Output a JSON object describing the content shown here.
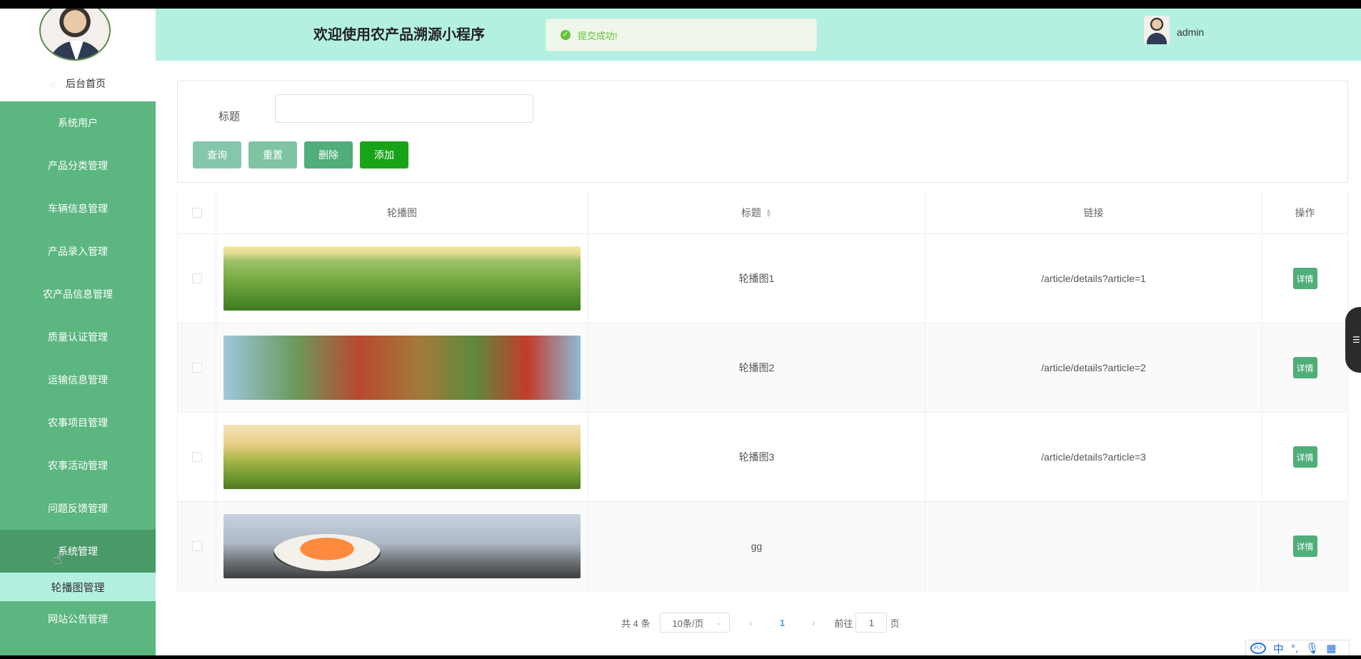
{
  "header": {
    "title": "欢迎使用农产品溯源小程序",
    "toast": "提交成功!",
    "user": "admin"
  },
  "sidebar": {
    "home": "后台首页",
    "items": [
      {
        "label": "系统用户"
      },
      {
        "label": "产品分类管理"
      },
      {
        "label": "车辆信息管理"
      },
      {
        "label": "产品录入管理"
      },
      {
        "label": "农产品信息管理"
      },
      {
        "label": "质量认证管理"
      },
      {
        "label": "运输信息管理"
      },
      {
        "label": "农事项目管理"
      },
      {
        "label": "农事活动管理"
      },
      {
        "label": "问题反馈管理"
      },
      {
        "label": "系统管理"
      }
    ],
    "submenu": [
      "轮播图管理",
      "网站公告管理"
    ]
  },
  "search": {
    "title_label": "标题",
    "title_value": "",
    "query": "查询",
    "reset": "重置",
    "delete": "删除",
    "add": "添加"
  },
  "table": {
    "headers": {
      "image": "轮播图",
      "title": "标题",
      "link": "链接",
      "op": "操作"
    },
    "rows": [
      {
        "title": "轮播图1",
        "link": "/article/details?article=1",
        "action": "详情"
      },
      {
        "title": "轮播图2",
        "link": "/article/details?article=2",
        "action": "详情"
      },
      {
        "title": "轮播图3",
        "link": "/article/details?article=3",
        "action": "详情"
      },
      {
        "title": "gg",
        "link": "",
        "action": "详情"
      }
    ]
  },
  "pagination": {
    "total": "共 4 条",
    "page_size": "10条/页",
    "current": "1",
    "goto_prefix": "前往",
    "goto_value": "1",
    "goto_suffix": "页"
  },
  "ime": {
    "mode": "中"
  }
}
